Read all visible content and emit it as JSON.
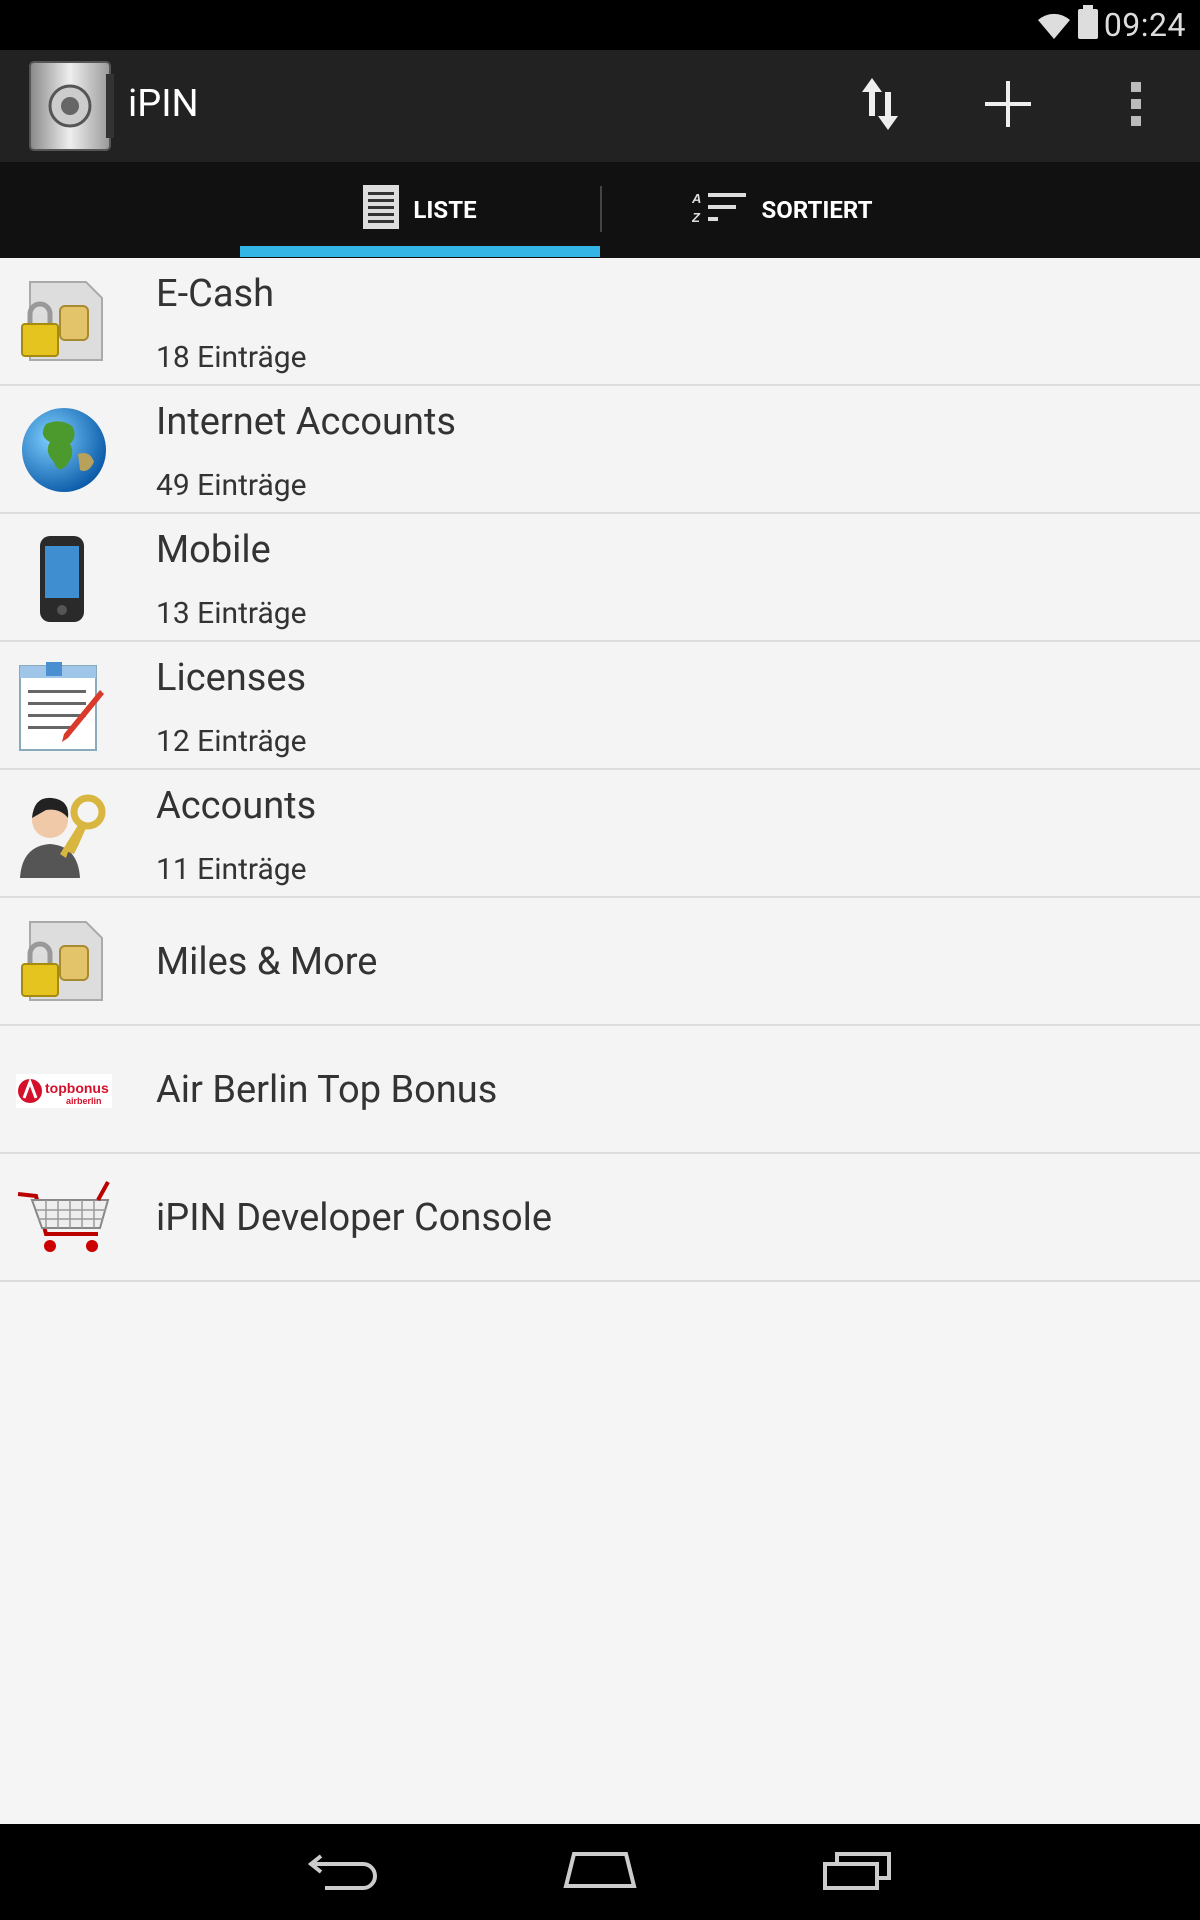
{
  "status_bar": {
    "time": "09:24",
    "wifi_icon": "wifi-icon",
    "battery_icon": "battery-icon"
  },
  "action_bar": {
    "title": "iPIN",
    "app_icon": "safe-icon",
    "sync_icon": "sync-arrows-icon",
    "add_icon": "plus-icon",
    "overflow_icon": "overflow-menu-icon"
  },
  "tabs": [
    {
      "label": "LISTE",
      "icon": "list-icon",
      "selected": true
    },
    {
      "label": "SORTIERT",
      "icon": "sort-az-icon",
      "selected": false
    }
  ],
  "colors": {
    "accent": "#33b5e5",
    "actionbar": "#222222",
    "tabbar": "#111111"
  },
  "items": [
    {
      "title": "E-Cash",
      "subtitle": "18 Einträge",
      "icon": "sim-card-lock-icon"
    },
    {
      "title": "Internet Accounts",
      "subtitle": "49 Einträge",
      "icon": "globe-icon"
    },
    {
      "title": "Mobile",
      "subtitle": "13 Einträge",
      "icon": "smartphone-icon"
    },
    {
      "title": "Licenses",
      "subtitle": "12 Einträge",
      "icon": "document-pen-icon"
    },
    {
      "title": "Accounts",
      "subtitle": "11 Einträge",
      "icon": "user-key-icon"
    },
    {
      "title": "Miles & More",
      "icon": "sim-card-lock-icon"
    },
    {
      "title": "Air Berlin Top Bonus",
      "icon": "topbonus-logo-icon",
      "logo_text": [
        "topbonus",
        "airberlin"
      ]
    },
    {
      "title": "iPIN Developer Console",
      "icon": "shopping-cart-icon"
    }
  ],
  "nav_bar": {
    "back": "back-icon",
    "home": "home-icon",
    "recents": "recents-icon"
  }
}
